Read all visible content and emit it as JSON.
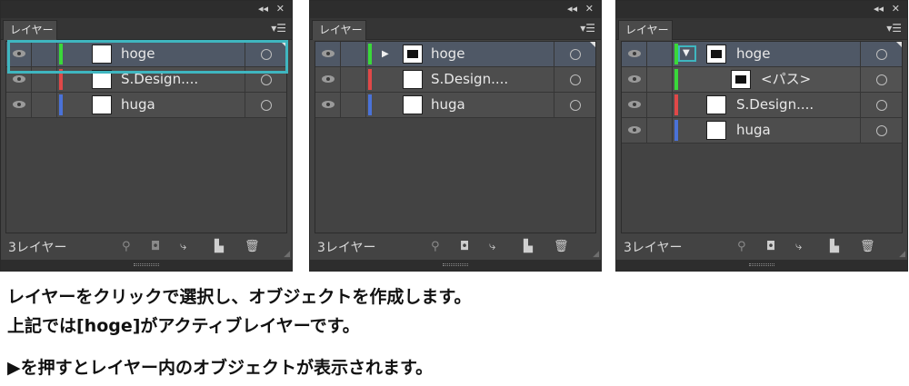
{
  "colors": {
    "green": "#3ad83a",
    "red": "#e04848",
    "blue": "#4a72d8",
    "highlight": "#3fb6c0"
  },
  "panels": [
    {
      "tab": "レイヤー",
      "count": "3レイヤー",
      "layers": [
        {
          "name": "hoge",
          "color": "green",
          "selected": true
        },
        {
          "name": "S.Design....",
          "color": "red"
        },
        {
          "name": "huga",
          "color": "blue"
        }
      ]
    },
    {
      "tab": "レイヤー",
      "count": "3レイヤー",
      "layers": [
        {
          "name": "hoge",
          "color": "green",
          "selected": true,
          "expander": "▶"
        },
        {
          "name": "S.Design....",
          "color": "red"
        },
        {
          "name": "huga",
          "color": "blue"
        }
      ]
    },
    {
      "tab": "レイヤー",
      "count": "3レイヤー",
      "layers": [
        {
          "name": "hoge",
          "color": "green",
          "selected": true,
          "expander": "▼"
        },
        {
          "name": "<パス>",
          "color": "green",
          "sublayer": true
        },
        {
          "name": "S.Design....",
          "color": "red"
        },
        {
          "name": "huga",
          "color": "blue"
        }
      ]
    }
  ],
  "captions": [
    "レイヤーをクリックで選択し、オブジェクトを作成します。",
    "上記では[hoge]がアクティブレイヤーです。",
    "▶を押すとレイヤー内のオブジェクトが表示されます。"
  ]
}
